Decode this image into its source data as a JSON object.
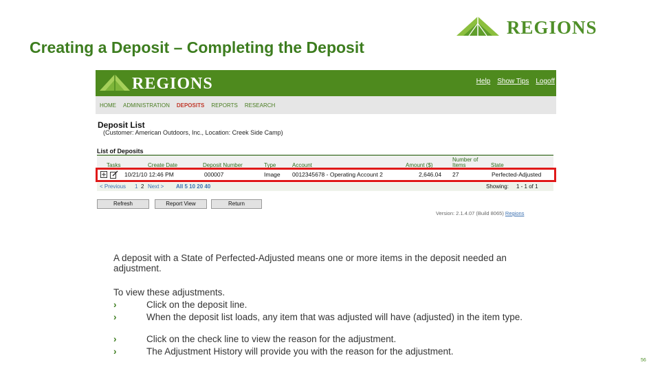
{
  "slide": {
    "title": "Creating a Deposit – Completing the Deposit",
    "logo_text": "REGIONS",
    "page_number": "56"
  },
  "app": {
    "logo_text": "REGIONS",
    "util_links": [
      "Help",
      "Show Tips",
      "Logoff"
    ],
    "nav": [
      "HOME",
      "ADMINISTRATION",
      "DEPOSITS",
      "REPORTS",
      "RESEARCH"
    ],
    "active_nav": "DEPOSITS",
    "deposit_list_title": "Deposit List",
    "deposit_list_subtitle": "(Customer: American Outdoors, Inc., Location: Creek Side Camp)",
    "list_title": "List of Deposits",
    "columns": {
      "tasks": "Tasks",
      "create_date": "Create Date",
      "deposit_number": "Deposit Number",
      "type": "Type",
      "account": "Account",
      "amount": "Amount ($)",
      "number_of_items_1": "Number of",
      "number_of_items_2": "Items",
      "state": "State"
    },
    "row": {
      "create_date": "10/21/10 12:46 PM",
      "deposit_number": "000007",
      "type": "Image",
      "account": "0012345678 - Operating Account 2",
      "amount": "2,646.04",
      "items": "27",
      "state": "Perfected-Adjusted"
    },
    "pager": {
      "previous": "< Previous",
      "page1": "1",
      "page2": "2",
      "next": "Next >",
      "sizes": "All 5 10 20 40",
      "showing_label": "Showing:",
      "showing_value": "1 - 1 of 1"
    },
    "buttons": {
      "refresh": "Refresh",
      "report_view": "Report View",
      "return": "Return"
    },
    "version_text": "Version: 2.1.4.07 (Build 8065)",
    "version_link": "Regions"
  },
  "body": {
    "intro": "A deposit with a State of Perfected-Adjusted means one or more items in the deposit needed an adjustment.",
    "steps_title": "To view these adjustments.",
    "bullet_glyph": "›",
    "steps": [
      "Click on the deposit line.",
      "When the deposit list loads, any item that was adjusted will have (adjusted) in the item type.",
      "Click on the check line to view the reason for the adjustment.",
      "The Adjustment History will provide you with the reason for the adjustment."
    ]
  },
  "colors": {
    "brand_green": "#4f8f28",
    "title_green": "#3d7d1f",
    "banner_green": "#4e8a1e",
    "highlight_red": "#e01a1a"
  }
}
